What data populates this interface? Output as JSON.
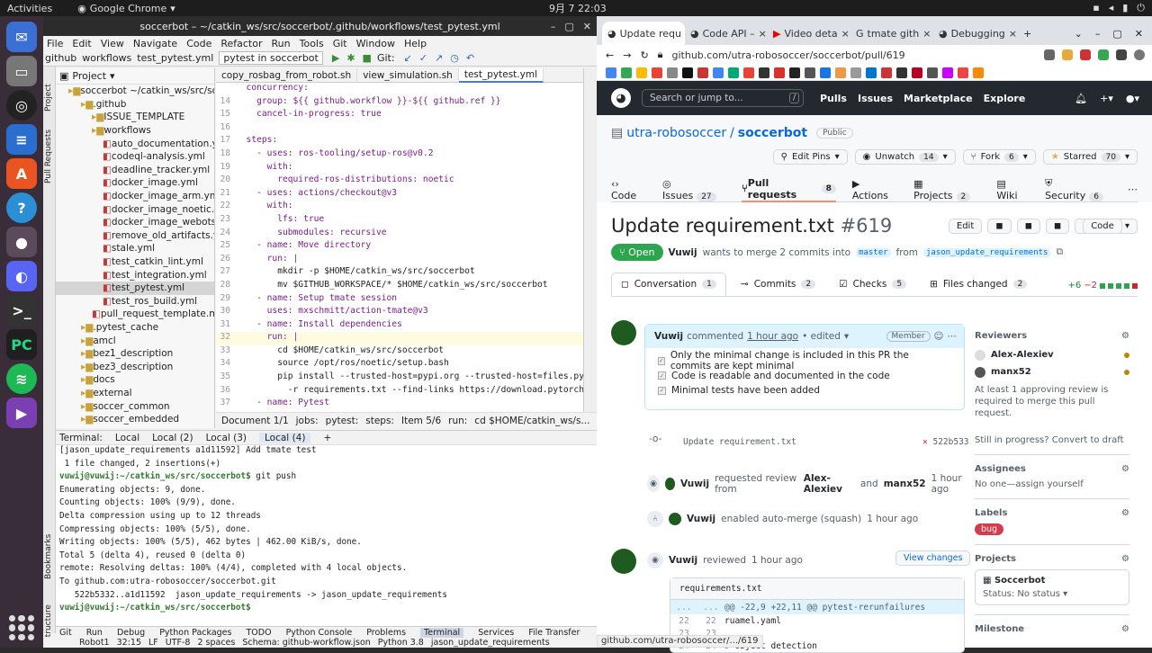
{
  "topbar": {
    "activities": "Activities",
    "app": "Google Chrome",
    "clock": "9月 7 22:03"
  },
  "ide": {
    "title": "soccerbot – ~/catkin_ws/src/soccerbot/.github/workflows/test_pytest.yml",
    "menu": [
      "File",
      "Edit",
      "View",
      "Navigate",
      "Code",
      "Refactor",
      "Run",
      "Tools",
      "Git",
      "Window",
      "Help"
    ],
    "crumbs": [
      "github",
      "workflows",
      "test_pytest.yml"
    ],
    "run_config": "pytest in soccerbot",
    "git_label": "Git:",
    "project_label": "Project",
    "tree": [
      {
        "text": "soccerbot ~/catkin_ws/src/soc",
        "cls": "fold",
        "indent": 14
      },
      {
        "text": ".github",
        "cls": "fold",
        "indent": 28
      },
      {
        "text": "ISSUE_TEMPLATE",
        "cls": "fold",
        "indent": 40
      },
      {
        "text": "workflows",
        "cls": "fold",
        "indent": 40
      },
      {
        "text": "auto_documentation.yml",
        "cls": "yml",
        "indent": 52
      },
      {
        "text": "codeql-analysis.yml",
        "cls": "yml",
        "indent": 52
      },
      {
        "text": "deadline_tracker.yml",
        "cls": "yml",
        "indent": 52
      },
      {
        "text": "docker_image.yml",
        "cls": "yml",
        "indent": 52
      },
      {
        "text": "docker_image_arm.yml",
        "cls": "yml",
        "indent": 52
      },
      {
        "text": "docker_image_noetic.ym",
        "cls": "yml",
        "indent": 52
      },
      {
        "text": "docker_image_webots.ym",
        "cls": "yml",
        "indent": 52
      },
      {
        "text": "remove_old_artifacts.ym",
        "cls": "yml",
        "indent": 52
      },
      {
        "text": "stale.yml",
        "cls": "yml",
        "indent": 52
      },
      {
        "text": "test_catkin_lint.yml",
        "cls": "yml",
        "indent": 52
      },
      {
        "text": "test_integration.yml",
        "cls": "yml",
        "indent": 52
      },
      {
        "text": "test_pytest.yml",
        "cls": "yml sel",
        "indent": 52
      },
      {
        "text": "test_ros_build.yml",
        "cls": "yml",
        "indent": 52
      },
      {
        "text": "pull_request_template.md",
        "cls": "",
        "indent": 40
      },
      {
        "text": ".pytest_cache",
        "cls": "fold",
        "indent": 28
      },
      {
        "text": "amcl",
        "cls": "fold",
        "indent": 28
      },
      {
        "text": "bez1_description",
        "cls": "fold",
        "indent": 28
      },
      {
        "text": "bez3_description",
        "cls": "fold",
        "indent": 28
      },
      {
        "text": "docs",
        "cls": "fold",
        "indent": 28
      },
      {
        "text": "external",
        "cls": "fold",
        "indent": 28
      },
      {
        "text": "soccer_common",
        "cls": "fold",
        "indent": 28
      },
      {
        "text": "soccer_embedded",
        "cls": "fold",
        "indent": 28
      }
    ],
    "editor_tabs": [
      "copy_rosbag_from_robot.sh",
      "view_simulation.sh",
      "test_pytest.yml"
    ],
    "code": [
      {
        "n": "",
        "t": "  concurrency:"
      },
      {
        "n": "14",
        "t": "    group: ${{ github.workflow }}-${{ github.ref }}"
      },
      {
        "n": "15",
        "t": "    cancel-in-progress: true"
      },
      {
        "n": "16",
        "t": ""
      },
      {
        "n": "17",
        "t": "  steps:"
      },
      {
        "n": "18",
        "t": "    - uses: ros-tooling/setup-ros@v0.2"
      },
      {
        "n": "19",
        "t": "      with:"
      },
      {
        "n": "20",
        "t": "        required-ros-distributions: noetic"
      },
      {
        "n": "21",
        "t": "    - uses: actions/checkout@v3"
      },
      {
        "n": "22",
        "t": "      with:"
      },
      {
        "n": "23",
        "t": "        lfs: true"
      },
      {
        "n": "24",
        "t": "        submodules: recursive"
      },
      {
        "n": "25",
        "t": "    - name: Move directory"
      },
      {
        "n": "26",
        "t": "      run: |"
      },
      {
        "n": "27",
        "t": "        mkdir -p $HOME/catkin_ws/src/soccerbot"
      },
      {
        "n": "28",
        "t": "        mv $GITHUB_WORKSPACE/* $HOME/catkin_ws/src/soccerbot"
      },
      {
        "n": "29",
        "t": "    - name: Setup tmate session"
      },
      {
        "n": "30",
        "t": "      uses: mxschmitt/action-tmate@v3"
      },
      {
        "n": "31",
        "t": "    - name: Install dependencies"
      },
      {
        "n": "32",
        "t": "      run: |"
      },
      {
        "n": "33",
        "t": "        cd $HOME/catkin_ws/src/soccerbot"
      },
      {
        "n": "34",
        "t": "        source /opt/ros/noetic/setup.bash"
      },
      {
        "n": "35",
        "t": "        pip install --trusted-host=pypi.org --trusted-host=files.py"
      },
      {
        "n": "36",
        "t": "          -r requirements.txt --find-links https://download.pytorch"
      },
      {
        "n": "37",
        "t": "    - name: Pytest"
      }
    ],
    "editor_status": [
      "Document 1/1",
      "jobs:",
      "pytest:",
      "steps:",
      "Item 5/6",
      "run:",
      "cd $HOME/catkin_ws/s..."
    ],
    "terminal_tabs": [
      "Terminal:",
      "Local",
      "Local (2)",
      "Local (3)",
      "Local (4)",
      "+"
    ],
    "terminal": [
      "[jason_update_requirements a1d11592] Add tmate test",
      " 1 file changed, 2 insertions(+)",
      "vuwij@vuwij:~/catkin_ws/src/soccerbot$ git push",
      "Enumerating objects: 9, done.",
      "Counting objects: 100% (9/9), done.",
      "Delta compression using up to 12 threads",
      "Compressing objects: 100% (5/5), done.",
      "Writing objects: 100% (5/5), 462 bytes | 462.00 KiB/s, done.",
      "Total 5 (delta 4), reused 0 (delta 0)",
      "remote: Resolving deltas: 100% (4/4), completed with 4 local objects.",
      "To github.com:utra-robosoccer/soccerbot.git",
      "   522b5332..a1d11592  jason_update_requirements -> jason_update_requirements",
      "vuwij@vuwij:~/catkin_ws/src/soccerbot$ "
    ],
    "tool_windows": [
      "Git",
      "Run",
      "Debug",
      "Python Packages",
      "TODO",
      "Python Console",
      "Problems",
      "Terminal",
      "Services",
      "File Transfer"
    ],
    "status": [
      "Robot1",
      "32:15",
      "LF",
      "UTF-8",
      "2 spaces",
      "Schema: github-workflow.json",
      "Python 3.8",
      "jason_update_requirements"
    ],
    "side_labels": [
      "Project",
      "Pull Requests",
      "Bookmarks",
      "Structure"
    ]
  },
  "chrome": {
    "tabs": [
      "Update requ",
      "Code API –",
      "Video deta",
      "tmate gith",
      "Debugging"
    ],
    "url": "github.com/utra-robosoccer/soccerbot/pull/619",
    "status_url": "github.com/utra-robosoccer/.../619"
  },
  "github": {
    "search": "Search or jump to...",
    "search_key": "/",
    "nav": [
      "Pulls",
      "Issues",
      "Marketplace",
      "Explore"
    ],
    "owner": "utra-robosoccer",
    "sep": "/",
    "repo": "soccerbot",
    "visibility": "Public",
    "actions": {
      "edit_pins": "Edit Pins",
      "unwatch": "Unwatch",
      "watch_count": "14",
      "fork": "Fork",
      "fork_count": "6",
      "starred": "Starred",
      "star_count": "70"
    },
    "repo_nav": [
      {
        "label": "Code",
        "count": ""
      },
      {
        "label": "Issues",
        "count": "27"
      },
      {
        "label": "Pull requests",
        "count": "8"
      },
      {
        "label": "Actions",
        "count": ""
      },
      {
        "label": "Projects",
        "count": "2"
      },
      {
        "label": "Wiki",
        "count": ""
      },
      {
        "label": "Security",
        "count": "6"
      }
    ],
    "pr": {
      "title": "Update requirement.txt",
      "number": "#619",
      "edit": "Edit",
      "code": "Code",
      "state": "Open",
      "author": "Vuwij",
      "meta1": "wants to merge 2 commits into",
      "base": "master",
      "from": "from",
      "head": "jason_update_requirements"
    },
    "pr_tabs": [
      {
        "label": "Conversation",
        "count": "1"
      },
      {
        "label": "Commits",
        "count": "2"
      },
      {
        "label": "Checks",
        "count": "5"
      },
      {
        "label": "Files changed",
        "count": "2"
      }
    ],
    "diffstat": {
      "add": "+6",
      "del": "−2"
    },
    "comment": {
      "author": "Vuwij",
      "verb": "commented",
      "time": "1 hour ago",
      "edited": "• edited",
      "role": "Member",
      "items": [
        "Only the minimal change is included in this PR the commits are kept minimal",
        "Code is readable and documented in the code",
        "Minimal tests have been added"
      ]
    },
    "commit_msg": "Update requirement.txt",
    "commit_sha": "522b533",
    "events": [
      {
        "user": "Vuwij",
        "text": "requested review from",
        "a": "Alex-Alexiev",
        "and": "and",
        "b": "manx52",
        "time": "1 hour ago"
      },
      {
        "user": "Vuwij",
        "text": "enabled auto-merge (squash)",
        "time": "1 hour ago"
      }
    ],
    "review": {
      "user": "Vuwij",
      "text": "reviewed",
      "time": "1 hour ago",
      "view": "View changes",
      "file": "requirements.txt",
      "hunk": "@@ -22,9 +22,11 @@ pytest-rerunfailures",
      "rows": [
        {
          "a": "22",
          "b": "22",
          "t": "ruamel.yaml"
        },
        {
          "a": "23",
          "b": "23",
          "t": ""
        },
        {
          "a": "24",
          "b": "24",
          "t": "# object detection"
        }
      ]
    },
    "sidebar": {
      "reviewers": "Reviewers",
      "r1": "Alex-Alexiev",
      "r2": "manx52",
      "rnote": "At least 1 approving review is required to merge this pull request.",
      "draft": "Still in progress? Convert to draft",
      "assignees": "Assignees",
      "noone": "No one—assign yourself",
      "labels": "Labels",
      "label": "bug",
      "projects": "Projects",
      "project": "Soccerbot",
      "pstatus": "Status: No status",
      "milestone": "Milestone"
    }
  }
}
